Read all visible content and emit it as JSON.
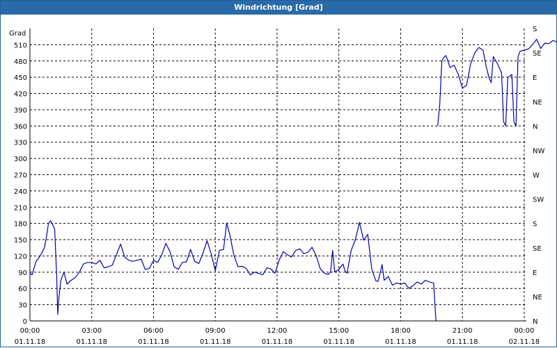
{
  "window": {
    "title": "Windrichtung [Grad]"
  },
  "chart_data": {
    "type": "line",
    "title": "Windrichtung [Grad]",
    "ylabel": "Grad",
    "ylim": [
      0,
      540
    ],
    "grid": true,
    "y_ticks": [
      0,
      30,
      60,
      90,
      120,
      150,
      180,
      210,
      240,
      270,
      300,
      330,
      360,
      390,
      420,
      450,
      480,
      510
    ],
    "right_ticks": [
      {
        "value": 0,
        "label": "N"
      },
      {
        "value": 45,
        "label": "NE"
      },
      {
        "value": 90,
        "label": "E"
      },
      {
        "value": 135,
        "label": "SE"
      },
      {
        "value": 180,
        "label": "S"
      },
      {
        "value": 225,
        "label": "SW"
      },
      {
        "value": 270,
        "label": "W"
      },
      {
        "value": 315,
        "label": "NW"
      },
      {
        "value": 360,
        "label": "N"
      },
      {
        "value": 405,
        "label": "NE"
      },
      {
        "value": 450,
        "label": "E"
      },
      {
        "value": 495,
        "label": "SE"
      },
      {
        "value": 540,
        "label": "S"
      }
    ],
    "x_ticks": [
      {
        "time": "00:00",
        "date": "01.11.18"
      },
      {
        "time": "03:00",
        "date": "01.11.18"
      },
      {
        "time": "06:00",
        "date": "01.11.18"
      },
      {
        "time": "09:00",
        "date": "01.11.18"
      },
      {
        "time": "12:00",
        "date": "01.11.18"
      },
      {
        "time": "15:00",
        "date": "01.11.18"
      },
      {
        "time": "18:00",
        "date": "01.11.18"
      },
      {
        "time": "21:00",
        "date": "01.11.18"
      },
      {
        "time": "00:00",
        "date": "02.11.18"
      }
    ],
    "xlim_hours": [
      0,
      24
    ],
    "line_color": "#0000aa",
    "series": [
      {
        "segments": [
          [
            [
              0.0,
              88
            ],
            [
              0.1,
              85
            ],
            [
              0.3,
              110
            ],
            [
              0.5,
              120
            ],
            [
              0.7,
              135
            ],
            [
              0.8,
              155
            ],
            [
              0.9,
              180
            ],
            [
              1.0,
              185
            ],
            [
              1.1,
              178
            ],
            [
              1.2,
              170
            ],
            [
              1.3,
              80
            ],
            [
              1.35,
              12
            ],
            [
              1.4,
              40
            ],
            [
              1.5,
              75
            ],
            [
              1.65,
              90
            ],
            [
              1.8,
              68
            ],
            [
              2.0,
              75
            ],
            [
              2.2,
              80
            ],
            [
              2.4,
              90
            ],
            [
              2.6,
              105
            ],
            [
              2.8,
              108
            ],
            [
              3.0,
              108
            ],
            [
              3.2,
              105
            ],
            [
              3.4,
              112
            ],
            [
              3.6,
              98
            ],
            [
              3.8,
              100
            ],
            [
              4.0,
              103
            ],
            [
              4.2,
              122
            ],
            [
              4.4,
              142
            ],
            [
              4.6,
              118
            ],
            [
              4.8,
              112
            ],
            [
              5.0,
              110
            ],
            [
              5.2,
              112
            ],
            [
              5.4,
              114
            ],
            [
              5.6,
              95
            ],
            [
              5.8,
              97
            ],
            [
              6.0,
              112
            ],
            [
              6.2,
              108
            ],
            [
              6.4,
              122
            ],
            [
              6.6,
              143
            ],
            [
              6.8,
              128
            ],
            [
              7.0,
              100
            ],
            [
              7.2,
              95
            ],
            [
              7.4,
              108
            ],
            [
              7.6,
              109
            ],
            [
              7.8,
              132
            ],
            [
              8.0,
              110
            ],
            [
              8.2,
              106
            ],
            [
              8.4,
              125
            ],
            [
              8.6,
              148
            ],
            [
              8.8,
              124
            ],
            [
              9.0,
              93
            ],
            [
              9.2,
              130
            ],
            [
              9.4,
              132
            ],
            [
              9.55,
              181
            ],
            [
              9.7,
              160
            ],
            [
              9.9,
              122
            ],
            [
              10.1,
              100
            ],
            [
              10.3,
              101
            ],
            [
              10.5,
              97
            ],
            [
              10.7,
              85
            ],
            [
              10.9,
              90
            ],
            [
              11.1,
              88
            ],
            [
              11.3,
              85
            ],
            [
              11.5,
              98
            ],
            [
              11.7,
              96
            ],
            [
              11.9,
              88
            ],
            [
              12.1,
              112
            ],
            [
              12.3,
              128
            ],
            [
              12.5,
              122
            ],
            [
              12.7,
              118
            ],
            [
              12.9,
              130
            ],
            [
              13.1,
              133
            ],
            [
              13.3,
              124
            ],
            [
              13.5,
              127
            ],
            [
              13.7,
              136
            ],
            [
              13.9,
              120
            ],
            [
              14.1,
              96
            ],
            [
              14.3,
              88
            ],
            [
              14.5,
              86
            ],
            [
              14.6,
              91
            ],
            [
              14.7,
              130
            ],
            [
              14.8,
              90
            ],
            [
              15.0,
              95
            ],
            [
              15.2,
              105
            ],
            [
              15.3,
              92
            ],
            [
              15.4,
              88
            ],
            [
              15.6,
              130
            ],
            [
              15.8,
              150
            ],
            [
              16.0,
              182
            ],
            [
              16.2,
              149
            ],
            [
              16.4,
              160
            ],
            [
              16.6,
              95
            ],
            [
              16.8,
              74
            ],
            [
              16.9,
              73
            ],
            [
              17.0,
              88
            ],
            [
              17.1,
              104
            ],
            [
              17.2,
              75
            ],
            [
              17.4,
              82
            ],
            [
              17.6,
              66
            ],
            [
              17.8,
              70
            ],
            [
              18.0,
              68
            ],
            [
              18.2,
              70
            ],
            [
              18.4,
              60
            ],
            [
              18.6,
              65
            ],
            [
              18.8,
              72
            ],
            [
              19.0,
              68
            ],
            [
              19.2,
              75
            ],
            [
              19.4,
              72
            ],
            [
              19.6,
              70
            ],
            [
              19.65,
              40
            ],
            [
              19.7,
              10
            ],
            [
              19.72,
              0
            ]
          ],
          [
            [
              19.8,
              360
            ],
            [
              19.9,
              400
            ],
            [
              20.0,
              480
            ],
            [
              20.1,
              487
            ],
            [
              20.2,
              490
            ],
            [
              20.4,
              468
            ],
            [
              20.6,
              472
            ],
            [
              20.8,
              455
            ],
            [
              21.0,
              430
            ],
            [
              21.2,
              435
            ],
            [
              21.4,
              475
            ],
            [
              21.6,
              495
            ],
            [
              21.8,
              505
            ],
            [
              22.0,
              500
            ],
            [
              22.15,
              470
            ],
            [
              22.3,
              448
            ],
            [
              22.4,
              440
            ],
            [
              22.5,
              488
            ],
            [
              22.7,
              475
            ],
            [
              22.9,
              458
            ],
            [
              23.0,
              368
            ],
            [
              23.1,
              360
            ],
            [
              23.2,
              450
            ],
            [
              23.4,
              455
            ],
            [
              23.5,
              368
            ],
            [
              23.6,
              360
            ],
            [
              23.7,
              488
            ],
            [
              23.8,
              498
            ],
            [
              24.0,
              500
            ],
            [
              24.2,
              502
            ],
            [
              24.4,
              510
            ],
            [
              24.6,
              520
            ],
            [
              24.8,
              503
            ],
            [
              25.0,
              513
            ],
            [
              25.2,
              512
            ],
            [
              25.4,
              518
            ],
            [
              25.6,
              515
            ],
            [
              25.8,
              517
            ]
          ]
        ]
      }
    ]
  }
}
